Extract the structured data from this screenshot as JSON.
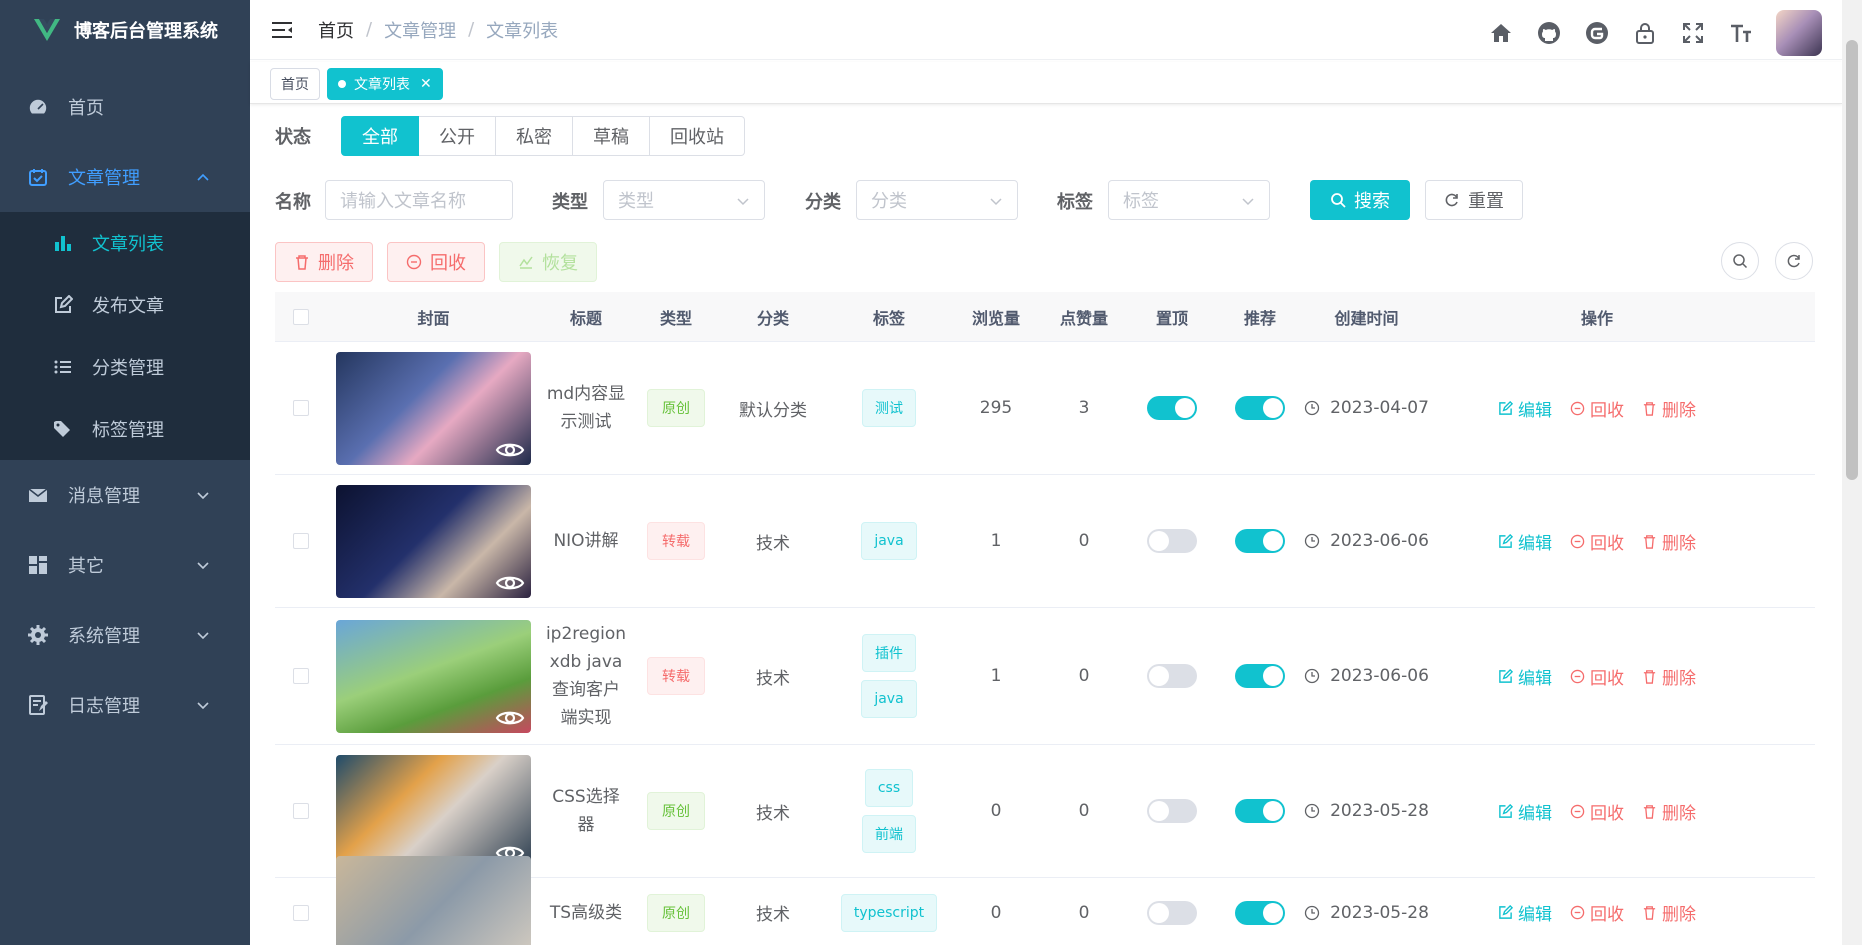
{
  "app": {
    "title": "博客后台管理系统"
  },
  "sidebar": {
    "items": [
      {
        "label": "首页",
        "icon": "dashboard-icon"
      },
      {
        "label": "文章管理",
        "icon": "article-icon",
        "expanded": true,
        "children": [
          {
            "label": "文章列表",
            "icon": "bar-chart-icon",
            "active": true
          },
          {
            "label": "发布文章",
            "icon": "edit-icon"
          },
          {
            "label": "分类管理",
            "icon": "list-icon"
          },
          {
            "label": "标签管理",
            "icon": "tag-icon"
          }
        ]
      },
      {
        "label": "消息管理",
        "icon": "mail-icon"
      },
      {
        "label": "其它",
        "icon": "grid-icon"
      },
      {
        "label": "系统管理",
        "icon": "gear-icon"
      },
      {
        "label": "日志管理",
        "icon": "log-icon"
      }
    ]
  },
  "header": {
    "breadcrumb": [
      "首页",
      "文章管理",
      "文章列表"
    ],
    "separator": "/",
    "icons": [
      "home-icon",
      "github-icon",
      "gitee-icon",
      "lock-icon",
      "fullscreen-icon",
      "font-size-icon"
    ]
  },
  "tags": [
    {
      "label": "首页"
    },
    {
      "label": "文章列表",
      "active": true
    }
  ],
  "status": {
    "label": "状态",
    "options": [
      "全部",
      "公开",
      "私密",
      "草稿",
      "回收站"
    ],
    "selected": "全部"
  },
  "filters": {
    "name_label": "名称",
    "name_placeholder": "请输入文章名称",
    "type_label": "类型",
    "type_placeholder": "类型",
    "category_label": "分类",
    "category_placeholder": "分类",
    "tag_label": "标签",
    "tag_placeholder": "标签",
    "search_button": "搜索",
    "reset_button": "重置"
  },
  "actions": {
    "delete": "删除",
    "recycle": "回收",
    "restore": "恢复"
  },
  "table": {
    "columns": [
      "封面",
      "标题",
      "类型",
      "分类",
      "标签",
      "浏览量",
      "点赞量",
      "置顶",
      "推荐",
      "创建时间",
      "操作"
    ],
    "op_labels": {
      "edit": "编辑",
      "recycle": "回收",
      "delete": "删除"
    },
    "rows": [
      {
        "title": "md内容显示测试",
        "title_lines": [
          "md内容显",
          "示测试"
        ],
        "type": "原创",
        "type_color": "green",
        "category": "默认分类",
        "tags": [
          "测试"
        ],
        "views": "295",
        "likes": "3",
        "top": true,
        "recommend": true,
        "date": "2023-04-07",
        "cover_gradient": "linear-gradient(135deg,#24365e,#5a6fb0 40%,#e6a9c2 60%,#1e2a4a)"
      },
      {
        "title": "NIO讲解",
        "title_lines": [
          "NIO讲解"
        ],
        "type": "转载",
        "type_color": "red",
        "category": "技术",
        "tags": [
          "java"
        ],
        "views": "1",
        "likes": "0",
        "top": false,
        "recommend": true,
        "date": "2023-06-06",
        "cover_gradient": "linear-gradient(135deg,#0c1230,#23306b 45%,#c9b7a8 70%,#2b2240)"
      },
      {
        "title": "ip2region xdb java 查询客户端实现",
        "title_lines": [
          "ip2region",
          "xdb java",
          "查询客户",
          "端实现"
        ],
        "type": "转载",
        "type_color": "red",
        "category": "技术",
        "tags": [
          "插件",
          "java"
        ],
        "views": "1",
        "likes": "0",
        "top": false,
        "recommend": true,
        "date": "2023-06-06",
        "cover_gradient": "linear-gradient(160deg,#6aa6d8,#9bcf7a 45%,#5a9d3c 70%,#c7485f)"
      },
      {
        "title": "CSS选择器",
        "title_lines": [
          "CSS选择",
          "器"
        ],
        "type": "原创",
        "type_color": "green",
        "category": "技术",
        "tags": [
          "css",
          "前端"
        ],
        "views": "0",
        "likes": "0",
        "top": false,
        "recommend": true,
        "date": "2023-05-28",
        "cover_gradient": "linear-gradient(135deg,#1f4b6b,#e3a14a 35%,#d9d0c8 55%,#2c3e50)"
      },
      {
        "title": "TS高级类",
        "title_lines": [
          "TS高级类"
        ],
        "type": "原创",
        "type_color": "green",
        "category": "技术",
        "tags": [
          "typescript"
        ],
        "views": "0",
        "likes": "0",
        "top": false,
        "recommend": true,
        "date": "2023-05-28",
        "cover_gradient": "linear-gradient(135deg,#c9b79a,#8c9aa8 50%,#d8cfc2)"
      }
    ]
  },
  "colors": {
    "accent": "#11c2cf",
    "sidebar_bg": "#304156",
    "submenu_bg": "#1f2d3d",
    "danger": "#f56c6c"
  }
}
